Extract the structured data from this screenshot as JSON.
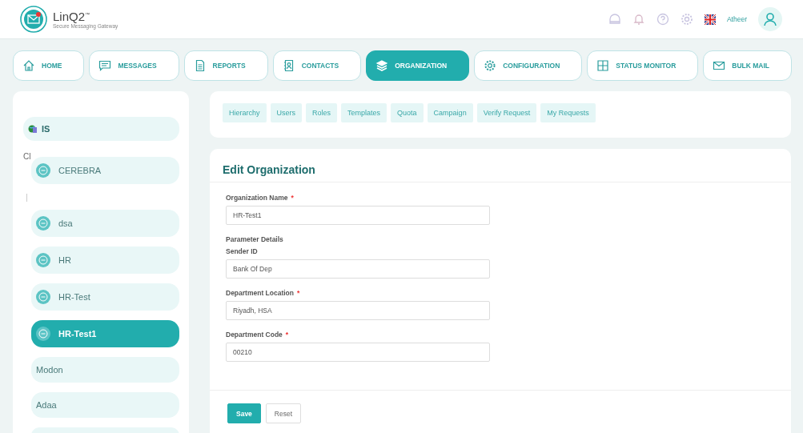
{
  "header": {
    "logo": {
      "name": "LinQ2",
      "trademark": "™",
      "tagline": "Secure Messaging Gateway"
    },
    "user": "Atheer"
  },
  "nav": [
    {
      "label": "HOME",
      "selected": false
    },
    {
      "label": "MESSAGES",
      "selected": false
    },
    {
      "label": "REPORTS",
      "selected": false
    },
    {
      "label": "CONTACTS",
      "selected": false
    },
    {
      "label": "ORGANIZATION",
      "selected": true
    },
    {
      "label": "CONFIGURATION",
      "selected": false
    },
    {
      "label": "STATUS MONITOR",
      "selected": false
    },
    {
      "label": "BULK MAIL",
      "selected": false
    }
  ],
  "sidebar": {
    "root": "IS",
    "cut_label": "Cl",
    "items": [
      {
        "label": "CEREBRA",
        "kind": "node",
        "selected": false
      },
      {
        "label": "dsa",
        "kind": "node",
        "selected": false
      },
      {
        "label": "HR",
        "kind": "node",
        "selected": false
      },
      {
        "label": "HR-Test",
        "kind": "node",
        "selected": false
      },
      {
        "label": "HR-Test1",
        "kind": "node",
        "selected": true
      },
      {
        "label": "Modon",
        "kind": "leaf",
        "selected": false
      },
      {
        "label": "Adaa",
        "kind": "leaf",
        "selected": false
      }
    ]
  },
  "subtabs": [
    "Hierarchy",
    "Users",
    "Roles",
    "Templates",
    "Quota",
    "Campaign",
    "Verify Request",
    "My Requests"
  ],
  "form": {
    "title": "Edit Organization",
    "required_mark": "*",
    "rows": [
      {
        "kind": "field",
        "label": "Organization Name",
        "required": true,
        "value": "HR-Test1"
      },
      {
        "kind": "heading",
        "label": "Parameter Details"
      },
      {
        "kind": "field",
        "label": "Sender ID",
        "required": false,
        "value": "Bank Of Dep"
      },
      {
        "kind": "field",
        "label": "Department Location",
        "required": true,
        "value": "Riyadh, HSA"
      },
      {
        "kind": "field",
        "label": "Department Code",
        "required": true,
        "value": "00210"
      }
    ],
    "buttons": [
      {
        "label": "Save",
        "kind": "primary"
      },
      {
        "label": "Reset",
        "kind": "secondary"
      }
    ]
  }
}
